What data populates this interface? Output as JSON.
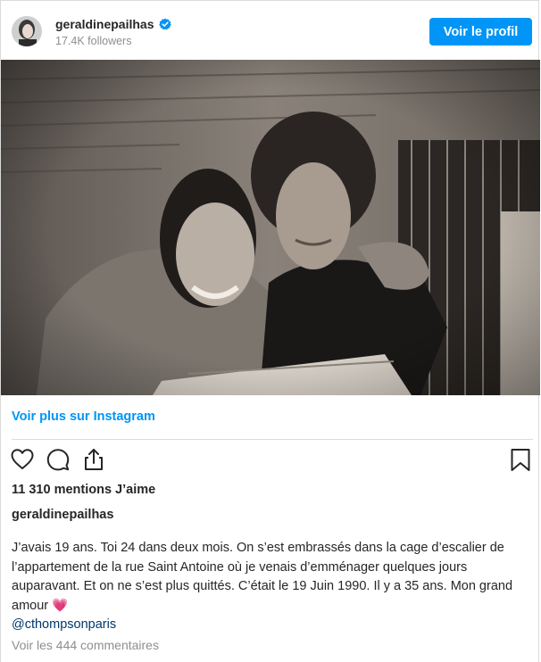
{
  "header": {
    "username": "geraldinepailhas",
    "followers": "17.4K followers",
    "profile_button": "Voir le profil"
  },
  "more_link": "Voir plus sur Instagram",
  "likes": "11 310 mentions J’aime",
  "caption": {
    "username": "geraldinepailhas",
    "text": "J’avais 19 ans. Toi 24 dans deux mois. On s’est embrassés dans la cage d’escalier de l’appartement de la rue Saint Antoine où je venais d’emménager quelques jours auparavant. Et on ne s’est plus quittés. C’était le 19 Juin 1990. Il y a 35 ans. Mon grand amour",
    "emoji": "💗",
    "mention": "@cthompsonparis"
  },
  "comments_link": "Voir les 444 commentaires",
  "icons": [
    "verified-badge-icon",
    "heart-icon",
    "comment-icon",
    "share-icon",
    "bookmark-icon"
  ],
  "colors": {
    "accent": "#0095f6",
    "link": "#00376b",
    "muted": "#8e8e8e",
    "heart": "#ed4956"
  }
}
